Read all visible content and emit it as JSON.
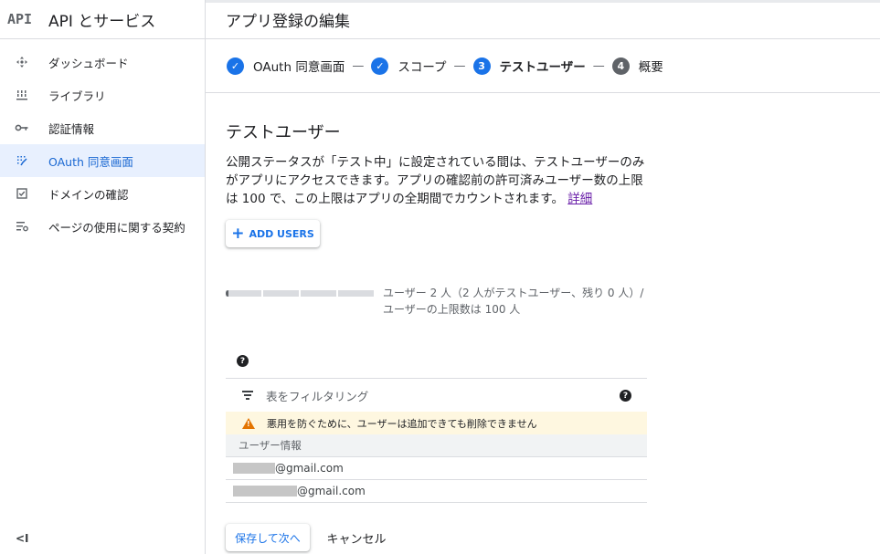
{
  "sidebar": {
    "logo": "API",
    "title": "API とサービス",
    "items": [
      {
        "label": "ダッシュボード",
        "icon": "dashboard-icon"
      },
      {
        "label": "ライブラリ",
        "icon": "library-icon"
      },
      {
        "label": "認証情報",
        "icon": "key-icon"
      },
      {
        "label": "OAuth 同意画面",
        "icon": "consent-icon",
        "active": true
      },
      {
        "label": "ドメインの確認",
        "icon": "checkbox-icon"
      },
      {
        "label": "ページの使用に関する契約",
        "icon": "settings-list-icon"
      }
    ],
    "collapse_label": "<I"
  },
  "header": {
    "title": "アプリ登録の編集"
  },
  "stepper": {
    "steps": [
      {
        "marker": "✓",
        "label": "OAuth 同意画面",
        "state": "done"
      },
      {
        "marker": "✓",
        "label": "スコープ",
        "state": "done"
      },
      {
        "marker": "3",
        "label": "テストユーザー",
        "state": "current"
      },
      {
        "marker": "4",
        "label": "概要",
        "state": "todo"
      }
    ],
    "separator": "—"
  },
  "main": {
    "section_title": "テストユーザー",
    "description": "公開ステータスが「テスト中」に設定されている間は、テストユーザーのみがアプリにアクセスできます。アプリの確認前の許可済みユーザー数の上限は 100 で、この上限はアプリの全期間でカウントされます。",
    "learn_more": "詳細",
    "add_users_label": "ADD USERS",
    "quota": {
      "fill_fraction": 0.02,
      "text": "ユーザー 2 人（2 人がテストユーザー、残り 0 人）/ ユーザーの上限数は 100 人"
    },
    "help_marker": "?",
    "table": {
      "filter_placeholder": "表をフィルタリング",
      "warning": "悪用を防ぐために、ユーザーは追加できても削除できません",
      "column_header": "ユーザー情報",
      "rows": [
        {
          "email_suffix": "@gmail.com"
        },
        {
          "email_suffix": "@gmail.com"
        }
      ]
    },
    "save_label": "保存して次へ",
    "cancel_label": "キャンセル"
  },
  "colors": {
    "accent": "#1a73e8",
    "active_bg": "#e8f0fe",
    "warning_bg": "#fef7e0",
    "warning_icon": "#e37400",
    "link_visited": "#681da8"
  }
}
